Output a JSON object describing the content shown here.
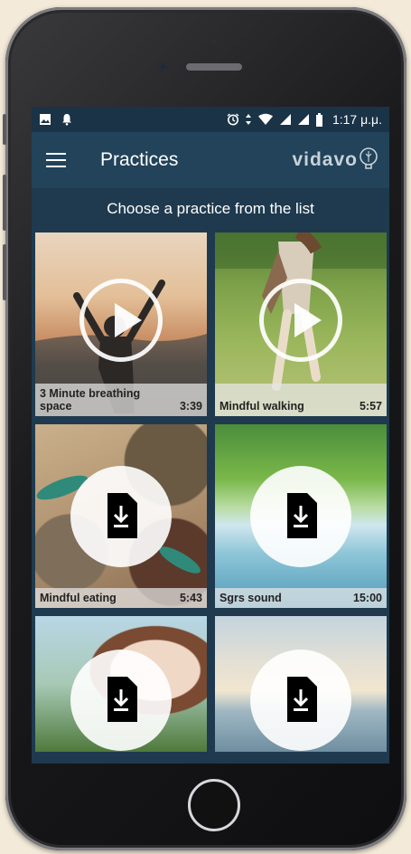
{
  "status_bar": {
    "time": "1:17 μ.μ.",
    "left_icons": [
      "image-icon",
      "alarm-bell-icon"
    ],
    "right_icons": [
      "alarm-clock-icon",
      "data-arrows-icon",
      "wifi-icon",
      "signal-icon",
      "signal-icon",
      "battery-icon"
    ]
  },
  "app_bar": {
    "title": "Practices",
    "logo_text": "vidavo"
  },
  "subtitle": "Choose a practice from the list",
  "practices": [
    {
      "name": "3 Minute breathing space",
      "duration": "3:39",
      "state": "play"
    },
    {
      "name": "Mindful walking",
      "duration": "5:57",
      "state": "play"
    },
    {
      "name": "Mindful eating",
      "duration": "5:43",
      "state": "download"
    },
    {
      "name": "Sgrs sound",
      "duration": "15:00",
      "state": "download"
    },
    {
      "name": "",
      "duration": "",
      "state": "download"
    },
    {
      "name": "",
      "duration": "",
      "state": "download"
    }
  ],
  "colors": {
    "app_bar": "#22435a",
    "screen_bg": "#1f3a4e",
    "page_bg": "#f3ead9"
  }
}
